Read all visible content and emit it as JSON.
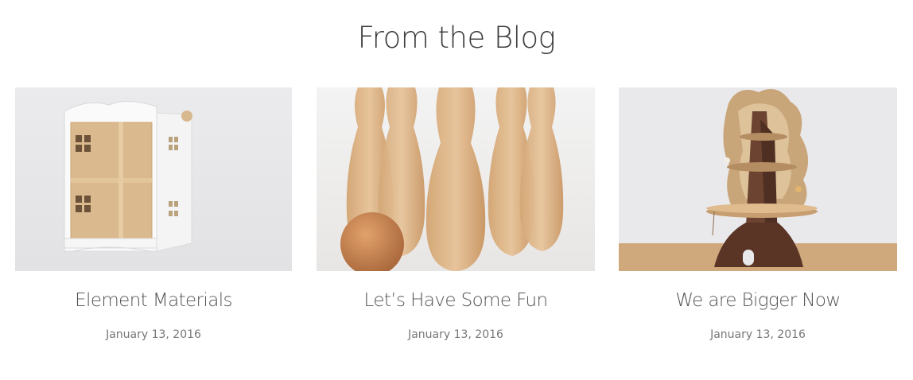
{
  "section": {
    "title": "From the Blog"
  },
  "posts": [
    {
      "title": "Element Materials",
      "date": "January 13, 2016",
      "image": "wooden-dollhouse-photo"
    },
    {
      "title": "Let’s Have Some Fun",
      "date": "January 13, 2016",
      "image": "wooden-bowling-pins-photo"
    },
    {
      "title": "We are Bigger Now",
      "date": "January 13, 2016",
      "image": "wooden-tree-house-photo"
    }
  ],
  "colors": {
    "title": "#3c3c3c",
    "post_title": "#555555",
    "date": "#777777"
  }
}
